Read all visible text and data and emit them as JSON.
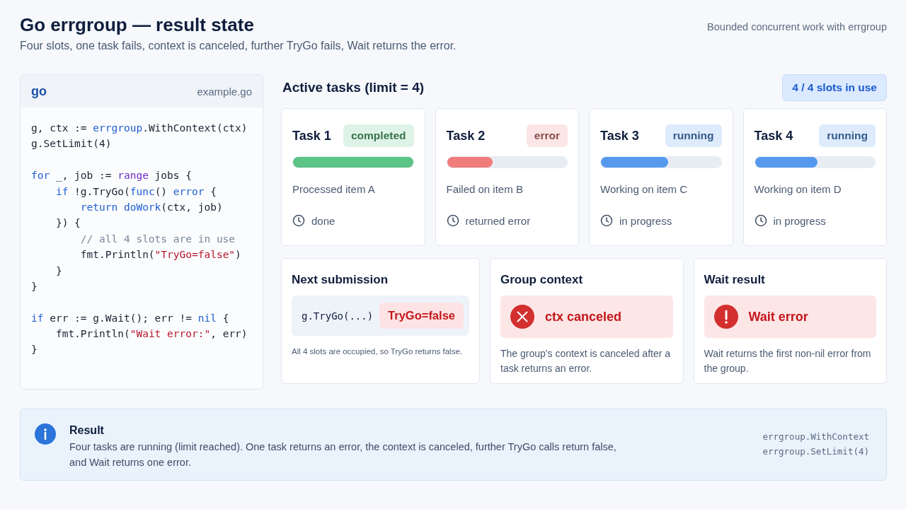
{
  "header": {
    "title": "Go errgroup — result state",
    "subtitle": "Four slots, one task fails, context is canceled, further TryGo fails, Wait returns the error.",
    "tagline": "Bounded concurrent work with errgroup"
  },
  "code_panel": {
    "language": "go",
    "filename": "example.go",
    "lines": [
      {
        "kind": "code",
        "tokens": [
          {
            "kind": "plain",
            "text": "g, ctx := "
          },
          {
            "kind": "kw",
            "text": "errgroup"
          },
          {
            "kind": "plain",
            "text": ".WithContext(ctx)"
          }
        ]
      },
      {
        "kind": "code",
        "tokens": [
          {
            "kind": "plain",
            "text": "g.SetLimit(4)"
          }
        ]
      },
      {
        "kind": "blank"
      },
      {
        "kind": "code",
        "tokens": [
          {
            "kind": "kw",
            "text": "for"
          },
          {
            "kind": "plain",
            "text": " _, job := "
          },
          {
            "kind": "builtin",
            "text": "range"
          },
          {
            "kind": "plain",
            "text": " jobs {"
          }
        ]
      },
      {
        "kind": "code",
        "tokens": [
          {
            "kind": "kw",
            "text": "    if"
          },
          {
            "kind": "plain",
            "text": " !g.TryGo("
          },
          {
            "kind": "kw",
            "text": "func"
          },
          {
            "kind": "plain",
            "text": "() "
          },
          {
            "kind": "kw",
            "text": "error"
          },
          {
            "kind": "plain",
            "text": " {"
          }
        ]
      },
      {
        "kind": "code",
        "tokens": [
          {
            "kind": "kw",
            "text": "        return doWork"
          },
          {
            "kind": "plain",
            "text": "(ctx, job)"
          }
        ]
      },
      {
        "kind": "code",
        "tokens": [
          {
            "kind": "plain",
            "text": "    }) {"
          }
        ]
      },
      {
        "kind": "code",
        "tokens": [
          {
            "kind": "comment",
            "text": "        // all 4 slots are in use"
          }
        ]
      },
      {
        "kind": "code",
        "tokens": [
          {
            "kind": "plain",
            "text": "        fmt.Println("
          },
          {
            "kind": "str",
            "text": "\"TryGo=false\""
          },
          {
            "kind": "plain",
            "text": ")"
          }
        ]
      },
      {
        "kind": "code",
        "tokens": [
          {
            "kind": "plain",
            "text": "    }"
          }
        ]
      },
      {
        "kind": "code",
        "tokens": [
          {
            "kind": "plain",
            "text": "}"
          }
        ]
      },
      {
        "kind": "blank"
      },
      {
        "kind": "code",
        "tokens": [
          {
            "kind": "kw",
            "text": "if"
          },
          {
            "kind": "plain",
            "text": " err := g.Wait(); err != "
          },
          {
            "kind": "kw",
            "text": "nil"
          },
          {
            "kind": "plain",
            "text": " {"
          }
        ]
      },
      {
        "kind": "code",
        "tokens": [
          {
            "kind": "plain",
            "text": "    fmt.Println("
          },
          {
            "kind": "str",
            "text": "\"Wait error:\""
          },
          {
            "kind": "plain",
            "text": ", err)"
          }
        ]
      },
      {
        "kind": "code",
        "tokens": [
          {
            "kind": "plain",
            "text": "}"
          }
        ]
      }
    ]
  },
  "tasks_section": {
    "title": "Active tasks (limit = 4)",
    "slots_badge": "4 / 4 slots in use"
  },
  "tasks": [
    {
      "name": "Task 1",
      "status": "completed",
      "color": "#5cc487",
      "level": 1.0,
      "detail": "Processed item A",
      "note": "done"
    },
    {
      "name": "Task 2",
      "status": "error",
      "color": "#f07c7c",
      "level": 0.38,
      "detail": "Failed on item B",
      "note": "returned error"
    },
    {
      "name": "Task 3",
      "status": "running",
      "color": "#5599ee",
      "level": 0.56,
      "detail": "Working on item C",
      "note": "in progress"
    },
    {
      "name": "Task 4",
      "status": "running",
      "color": "#5599ee",
      "level": 0.52,
      "detail": "Working on item D",
      "note": "in progress"
    }
  ],
  "info_cards": [
    {
      "kind": "submission",
      "title": "Next submission",
      "call": "g.TryGo(...)",
      "result": "TryGo=false",
      "description": "All 4 slots are occupied, so TryGo returns false."
    },
    {
      "kind": "canceled",
      "title": "Group context",
      "result": "ctx canceled",
      "description": "The group's context is canceled after a task returns an error."
    },
    {
      "kind": "error",
      "title": "Wait result",
      "result": "Wait error",
      "description": "Wait returns the first non-nil error from the group."
    }
  ],
  "result_box": {
    "title": "Result",
    "text": "Four tasks are running (limit reached). One task returns an error, the context is canceled, further TryGo calls return false, and Wait returns one error.",
    "api": [
      "errgroup.WithContext",
      "errgroup.SetLimit(4)"
    ]
  }
}
